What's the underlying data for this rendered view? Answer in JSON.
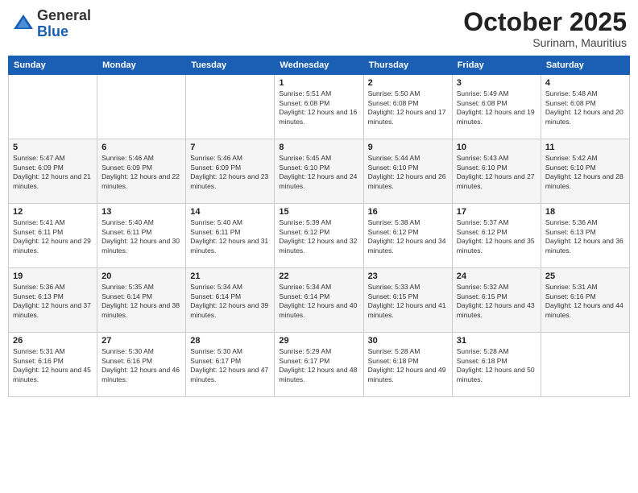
{
  "logo": {
    "general": "General",
    "blue": "Blue"
  },
  "header": {
    "month": "October 2025",
    "location": "Surinam, Mauritius"
  },
  "weekdays": [
    "Sunday",
    "Monday",
    "Tuesday",
    "Wednesday",
    "Thursday",
    "Friday",
    "Saturday"
  ],
  "weeks": [
    [
      {
        "day": "",
        "sunrise": "",
        "sunset": "",
        "daylight": ""
      },
      {
        "day": "",
        "sunrise": "",
        "sunset": "",
        "daylight": ""
      },
      {
        "day": "",
        "sunrise": "",
        "sunset": "",
        "daylight": ""
      },
      {
        "day": "1",
        "sunrise": "Sunrise: 5:51 AM",
        "sunset": "Sunset: 6:08 PM",
        "daylight": "Daylight: 12 hours and 16 minutes."
      },
      {
        "day": "2",
        "sunrise": "Sunrise: 5:50 AM",
        "sunset": "Sunset: 6:08 PM",
        "daylight": "Daylight: 12 hours and 17 minutes."
      },
      {
        "day": "3",
        "sunrise": "Sunrise: 5:49 AM",
        "sunset": "Sunset: 6:08 PM",
        "daylight": "Daylight: 12 hours and 19 minutes."
      },
      {
        "day": "4",
        "sunrise": "Sunrise: 5:48 AM",
        "sunset": "Sunset: 6:08 PM",
        "daylight": "Daylight: 12 hours and 20 minutes."
      }
    ],
    [
      {
        "day": "5",
        "sunrise": "Sunrise: 5:47 AM",
        "sunset": "Sunset: 6:09 PM",
        "daylight": "Daylight: 12 hours and 21 minutes."
      },
      {
        "day": "6",
        "sunrise": "Sunrise: 5:46 AM",
        "sunset": "Sunset: 6:09 PM",
        "daylight": "Daylight: 12 hours and 22 minutes."
      },
      {
        "day": "7",
        "sunrise": "Sunrise: 5:46 AM",
        "sunset": "Sunset: 6:09 PM",
        "daylight": "Daylight: 12 hours and 23 minutes."
      },
      {
        "day": "8",
        "sunrise": "Sunrise: 5:45 AM",
        "sunset": "Sunset: 6:10 PM",
        "daylight": "Daylight: 12 hours and 24 minutes."
      },
      {
        "day": "9",
        "sunrise": "Sunrise: 5:44 AM",
        "sunset": "Sunset: 6:10 PM",
        "daylight": "Daylight: 12 hours and 26 minutes."
      },
      {
        "day": "10",
        "sunrise": "Sunrise: 5:43 AM",
        "sunset": "Sunset: 6:10 PM",
        "daylight": "Daylight: 12 hours and 27 minutes."
      },
      {
        "day": "11",
        "sunrise": "Sunrise: 5:42 AM",
        "sunset": "Sunset: 6:10 PM",
        "daylight": "Daylight: 12 hours and 28 minutes."
      }
    ],
    [
      {
        "day": "12",
        "sunrise": "Sunrise: 5:41 AM",
        "sunset": "Sunset: 6:11 PM",
        "daylight": "Daylight: 12 hours and 29 minutes."
      },
      {
        "day": "13",
        "sunrise": "Sunrise: 5:40 AM",
        "sunset": "Sunset: 6:11 PM",
        "daylight": "Daylight: 12 hours and 30 minutes."
      },
      {
        "day": "14",
        "sunrise": "Sunrise: 5:40 AM",
        "sunset": "Sunset: 6:11 PM",
        "daylight": "Daylight: 12 hours and 31 minutes."
      },
      {
        "day": "15",
        "sunrise": "Sunrise: 5:39 AM",
        "sunset": "Sunset: 6:12 PM",
        "daylight": "Daylight: 12 hours and 32 minutes."
      },
      {
        "day": "16",
        "sunrise": "Sunrise: 5:38 AM",
        "sunset": "Sunset: 6:12 PM",
        "daylight": "Daylight: 12 hours and 34 minutes."
      },
      {
        "day": "17",
        "sunrise": "Sunrise: 5:37 AM",
        "sunset": "Sunset: 6:12 PM",
        "daylight": "Daylight: 12 hours and 35 minutes."
      },
      {
        "day": "18",
        "sunrise": "Sunrise: 5:36 AM",
        "sunset": "Sunset: 6:13 PM",
        "daylight": "Daylight: 12 hours and 36 minutes."
      }
    ],
    [
      {
        "day": "19",
        "sunrise": "Sunrise: 5:36 AM",
        "sunset": "Sunset: 6:13 PM",
        "daylight": "Daylight: 12 hours and 37 minutes."
      },
      {
        "day": "20",
        "sunrise": "Sunrise: 5:35 AM",
        "sunset": "Sunset: 6:14 PM",
        "daylight": "Daylight: 12 hours and 38 minutes."
      },
      {
        "day": "21",
        "sunrise": "Sunrise: 5:34 AM",
        "sunset": "Sunset: 6:14 PM",
        "daylight": "Daylight: 12 hours and 39 minutes."
      },
      {
        "day": "22",
        "sunrise": "Sunrise: 5:34 AM",
        "sunset": "Sunset: 6:14 PM",
        "daylight": "Daylight: 12 hours and 40 minutes."
      },
      {
        "day": "23",
        "sunrise": "Sunrise: 5:33 AM",
        "sunset": "Sunset: 6:15 PM",
        "daylight": "Daylight: 12 hours and 41 minutes."
      },
      {
        "day": "24",
        "sunrise": "Sunrise: 5:32 AM",
        "sunset": "Sunset: 6:15 PM",
        "daylight": "Daylight: 12 hours and 43 minutes."
      },
      {
        "day": "25",
        "sunrise": "Sunrise: 5:31 AM",
        "sunset": "Sunset: 6:16 PM",
        "daylight": "Daylight: 12 hours and 44 minutes."
      }
    ],
    [
      {
        "day": "26",
        "sunrise": "Sunrise: 5:31 AM",
        "sunset": "Sunset: 6:16 PM",
        "daylight": "Daylight: 12 hours and 45 minutes."
      },
      {
        "day": "27",
        "sunrise": "Sunrise: 5:30 AM",
        "sunset": "Sunset: 6:16 PM",
        "daylight": "Daylight: 12 hours and 46 minutes."
      },
      {
        "day": "28",
        "sunrise": "Sunrise: 5:30 AM",
        "sunset": "Sunset: 6:17 PM",
        "daylight": "Daylight: 12 hours and 47 minutes."
      },
      {
        "day": "29",
        "sunrise": "Sunrise: 5:29 AM",
        "sunset": "Sunset: 6:17 PM",
        "daylight": "Daylight: 12 hours and 48 minutes."
      },
      {
        "day": "30",
        "sunrise": "Sunrise: 5:28 AM",
        "sunset": "Sunset: 6:18 PM",
        "daylight": "Daylight: 12 hours and 49 minutes."
      },
      {
        "day": "31",
        "sunrise": "Sunrise: 5:28 AM",
        "sunset": "Sunset: 6:18 PM",
        "daylight": "Daylight: 12 hours and 50 minutes."
      },
      {
        "day": "",
        "sunrise": "",
        "sunset": "",
        "daylight": ""
      }
    ]
  ]
}
